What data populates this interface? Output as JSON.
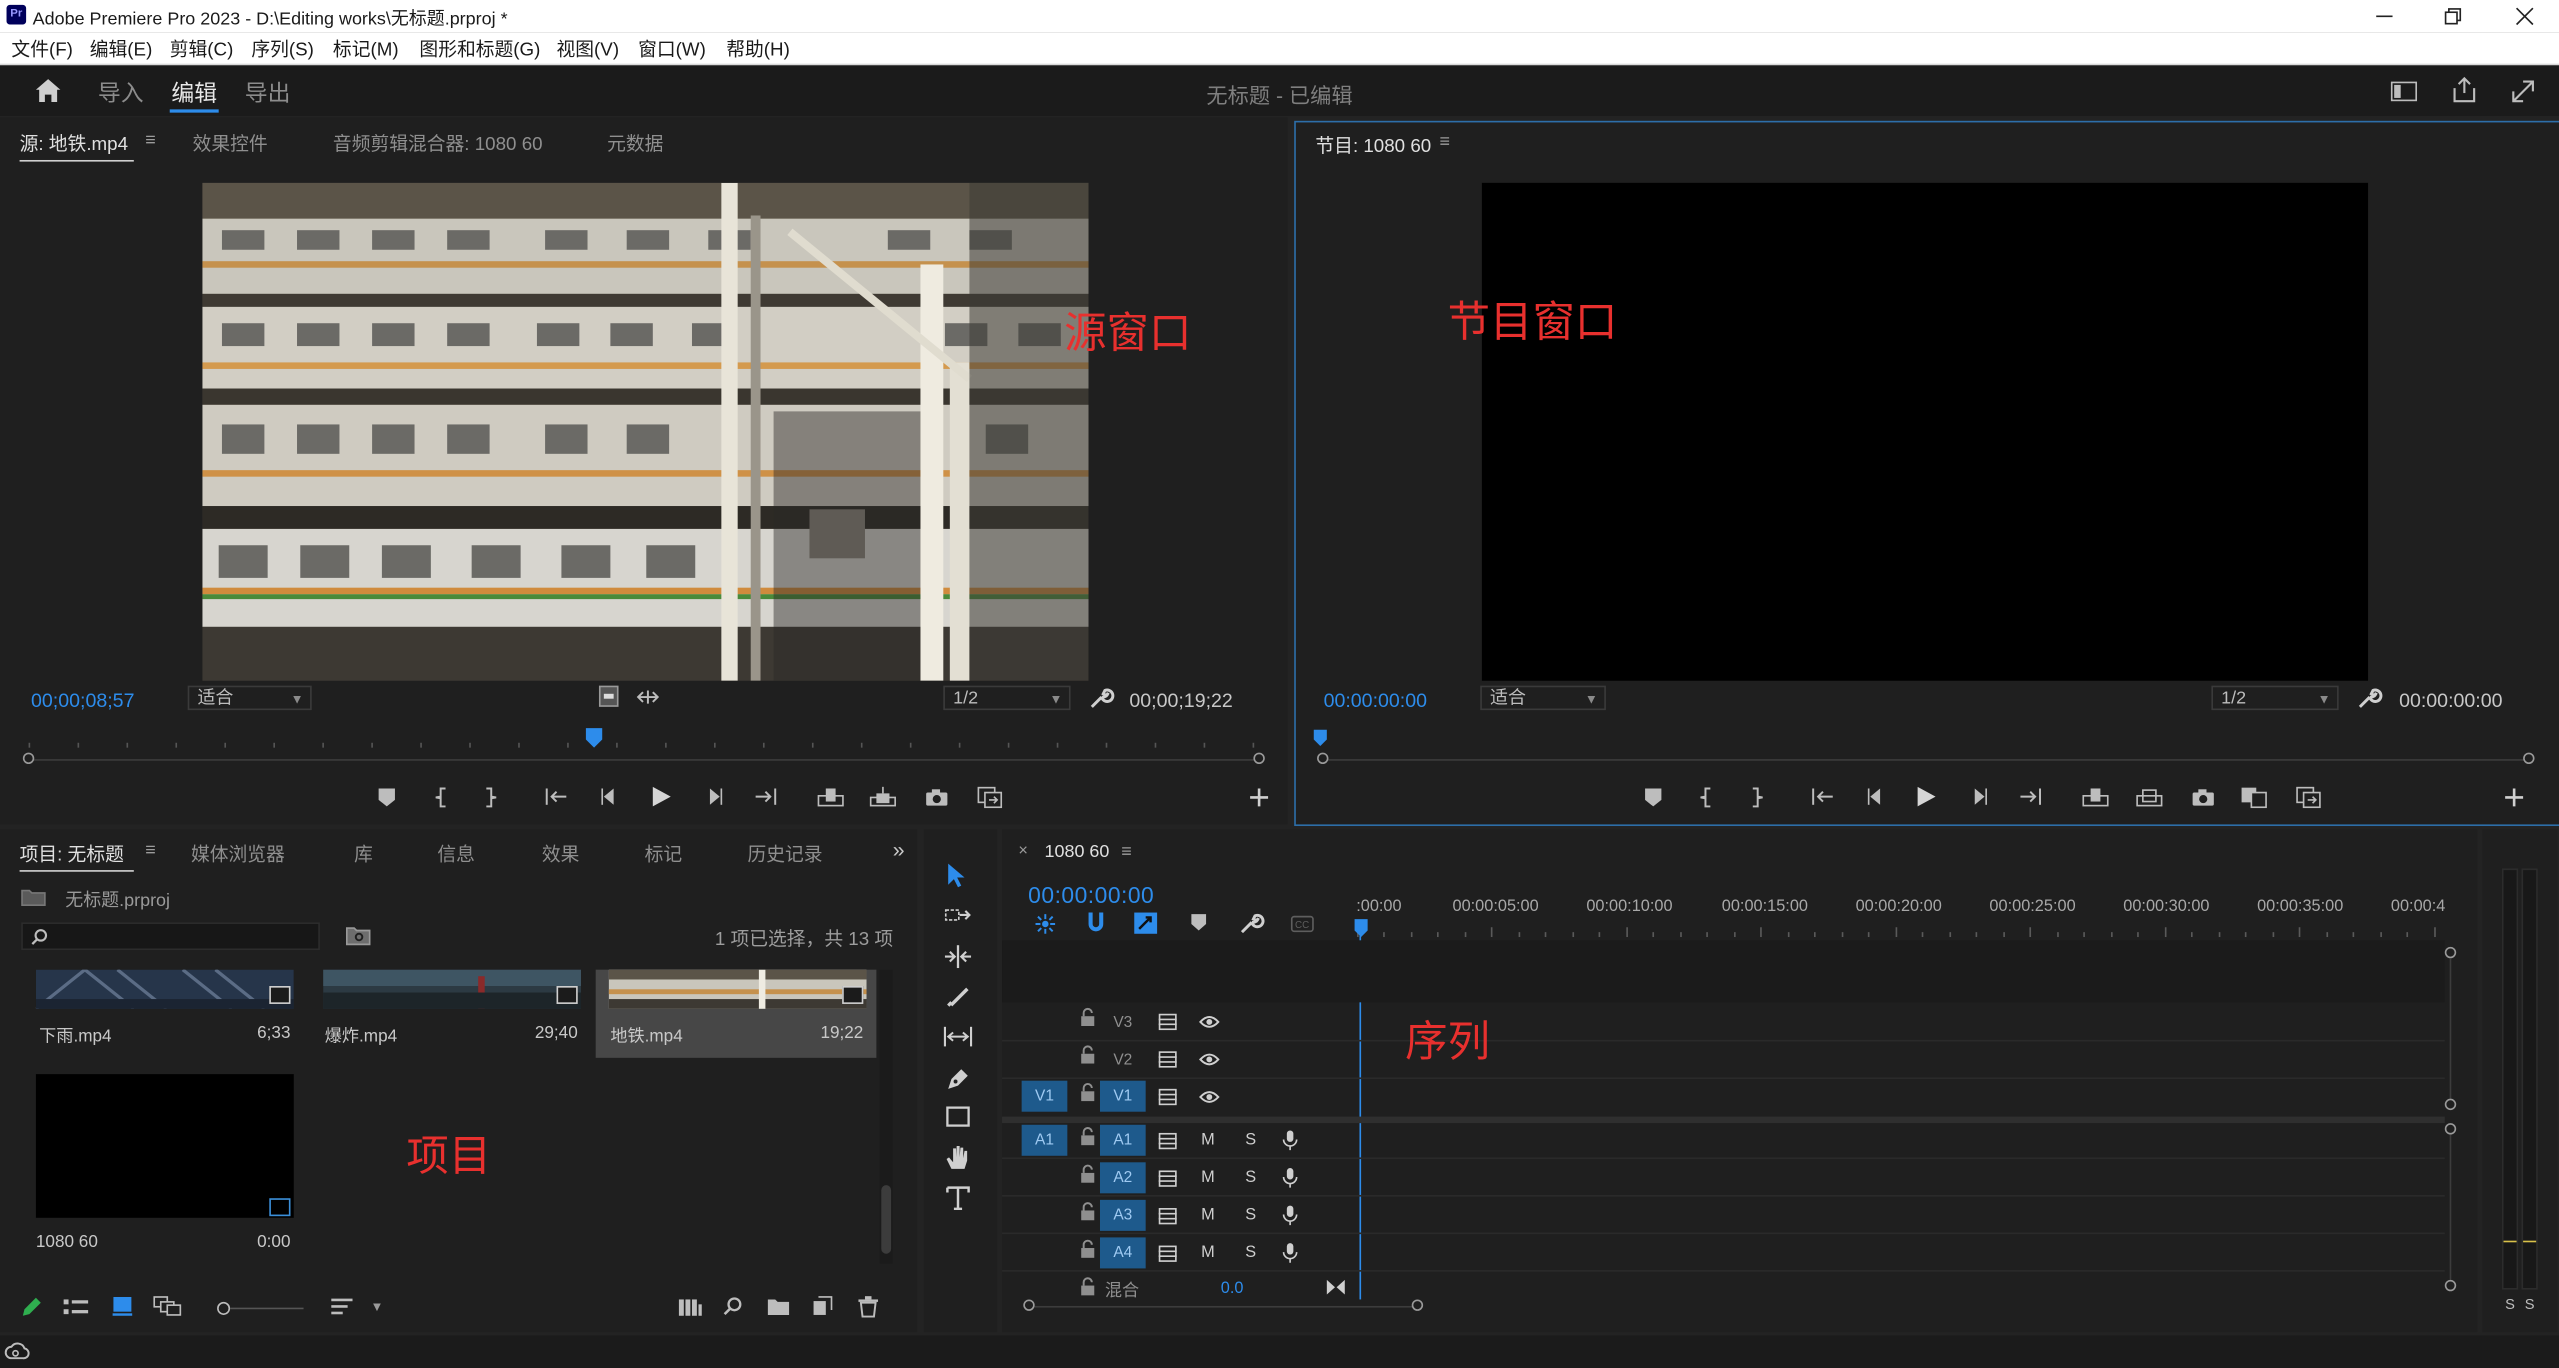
{
  "window": {
    "title": "Adobe Premiere Pro 2023 - D:\\Editing works\\无标题.prproj *",
    "app_icon": "Pr",
    "controls": [
      "minimize-icon",
      "restore-icon",
      "close-icon"
    ]
  },
  "menu": [
    "文件(F)",
    "编辑(E)",
    "剪辑(C)",
    "序列(S)",
    "标记(M)",
    "图形和标题(G)",
    "视图(V)",
    "窗口(W)",
    "帮助(H)"
  ],
  "workspace": {
    "tabs": [
      "导入",
      "编辑",
      "导出"
    ],
    "active_tab": "编辑",
    "project_title": "无标题 - 已编辑",
    "accent": "#2d8ceb"
  },
  "source": {
    "tabs": [
      "源: 地铁.mp4",
      "效果控件",
      "音频剪辑混合器: 1080 60",
      "元数据"
    ],
    "timecode_in": "00;00;08;57",
    "fit": "适合",
    "resolution": "1/2",
    "duration": "00;00;19;22",
    "annotation": "源窗口"
  },
  "program": {
    "tab": "节目: 1080 60",
    "timecode": "00:00:00:00",
    "fit": "适合",
    "resolution": "1/2",
    "duration": "00:00:00:00",
    "annotation": "节目窗口"
  },
  "project": {
    "tabs": [
      "项目: 无标题",
      "媒体浏览器",
      "库",
      "信息",
      "效果",
      "标记",
      "历史记录"
    ],
    "file": "无标题.prproj",
    "search_placeholder": "",
    "selection_info": "1 项已选择，共 13 项",
    "items": [
      {
        "name": "下雨.mp4",
        "duration": "6;33"
      },
      {
        "name": "爆炸.mp4",
        "duration": "29;40"
      },
      {
        "name": "地铁.mp4",
        "duration": "19;22"
      },
      {
        "name": "1080 60",
        "duration": "0:00"
      }
    ],
    "annotation": "项目"
  },
  "timeline": {
    "tab": "1080 60",
    "timecode": "00:00:00:00",
    "ruler": [
      ":00:00",
      "00:00:05:00",
      "00:00:10:00",
      "00:00:15:00",
      "00:00:20:00",
      "00:00:25:00",
      "00:00:30:00",
      "00:00:35:00",
      "00:00:4"
    ],
    "video_tracks": [
      "V3",
      "V2",
      "V1"
    ],
    "audio_tracks": [
      "A1",
      "A2",
      "A3",
      "A4"
    ],
    "source_patch_video": "V1",
    "source_patch_audio": "A1",
    "mix_label": "混合",
    "mix_value": "0.0",
    "mute_label": "M",
    "solo_label": "S",
    "annotation": "序列"
  },
  "meter": {
    "labels": [
      "S",
      "S"
    ]
  }
}
